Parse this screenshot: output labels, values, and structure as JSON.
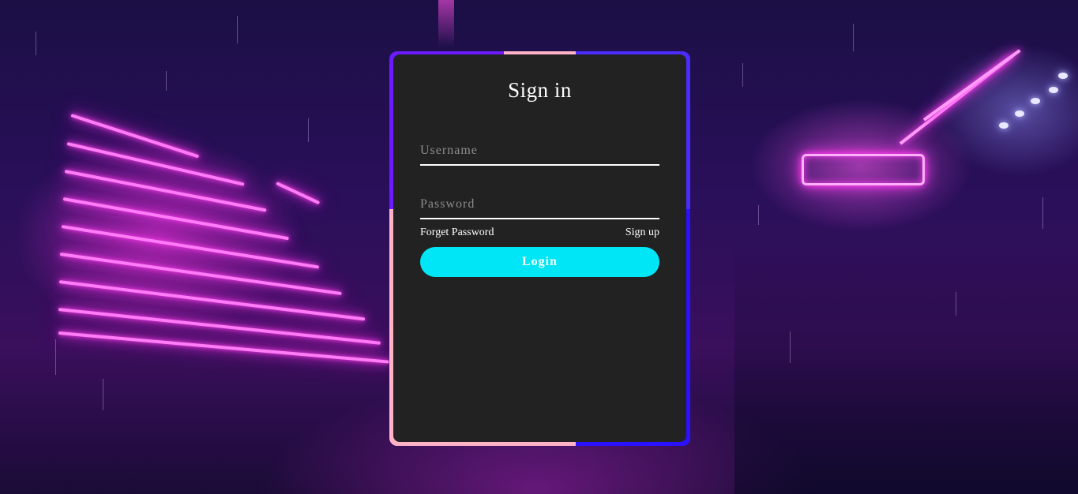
{
  "signin": {
    "title": "Sign in",
    "username_placeholder": "Username",
    "password_placeholder": "Password",
    "forget_password_label": "Forget Password",
    "signup_label": "Sign up",
    "login_label": "Login"
  },
  "colors": {
    "card_background": "#222222",
    "login_button": "#00e6f6",
    "neon_accent": "#ff3df0",
    "frame_violet": "#6a1bff",
    "frame_pink": "#ffb3c6"
  }
}
